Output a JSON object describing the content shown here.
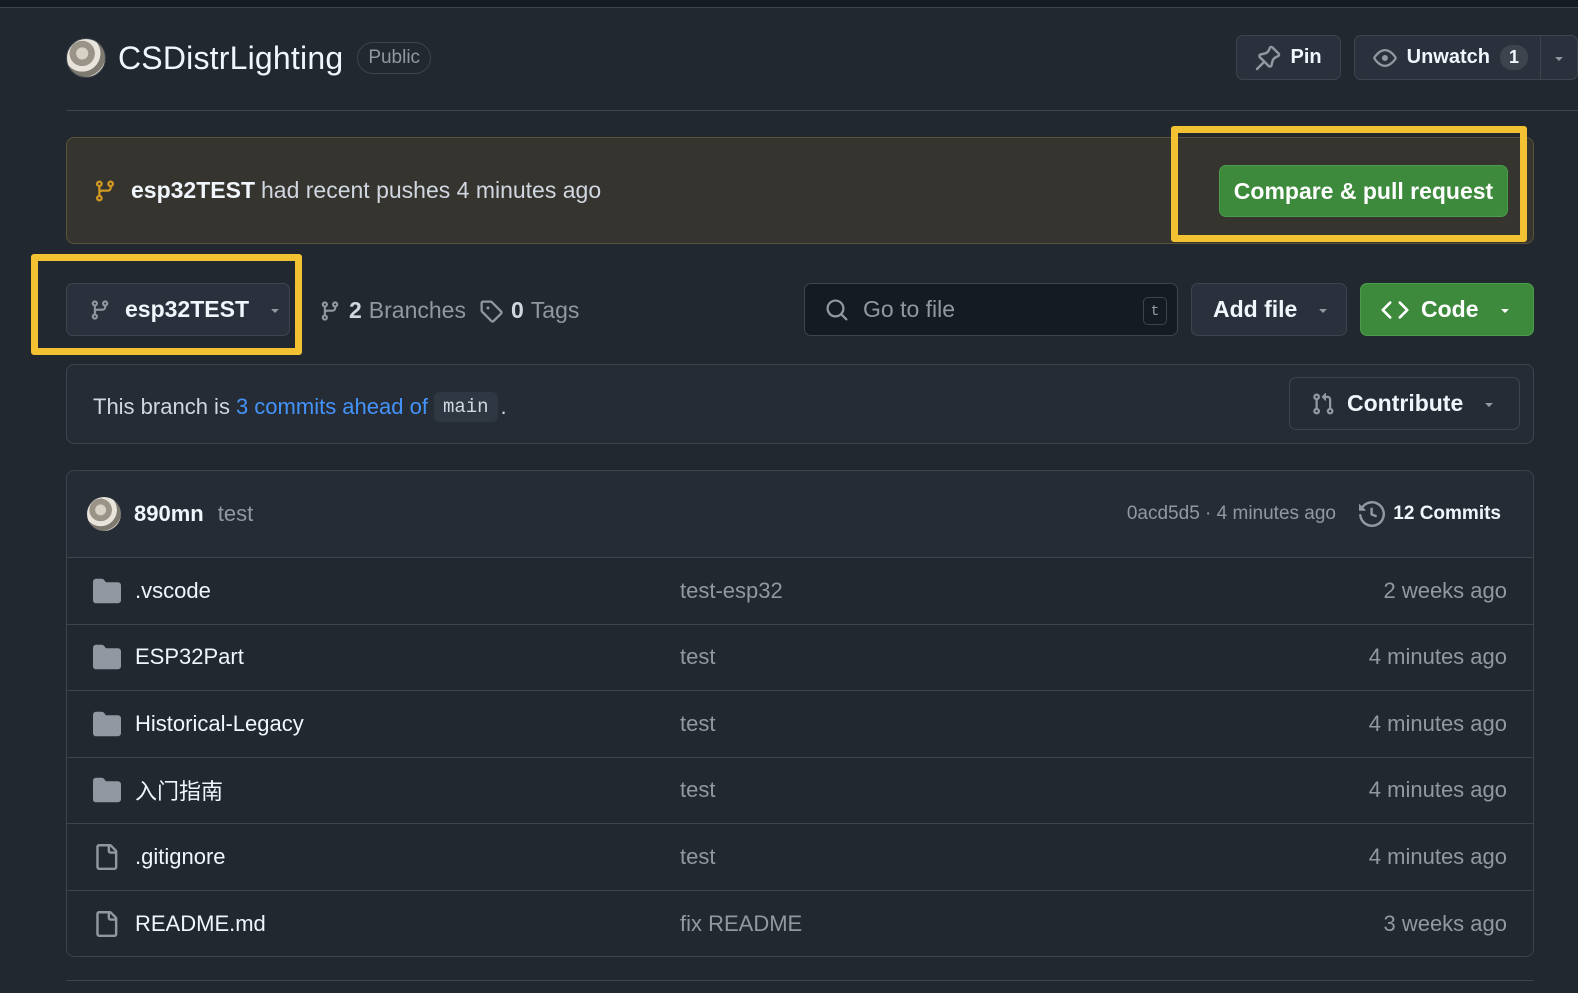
{
  "repo": {
    "name": "CSDistrLighting",
    "visibility": "Public",
    "pin_label": "Pin",
    "watch_label": "Unwatch",
    "watch_count": "1"
  },
  "push_banner": {
    "branch": "esp32TEST",
    "text": "had recent pushes 4 minutes ago",
    "button_label": "Compare & pull request"
  },
  "toolbar": {
    "branch": "esp32TEST",
    "branches_count": "2",
    "branches_label": "Branches",
    "tags_count": "0",
    "tags_label": "Tags",
    "search_placeholder": "Go to file",
    "search_shortcut": "t",
    "add_file_label": "Add file",
    "code_label": "Code"
  },
  "ahead": {
    "prefix": "This branch is",
    "link": "3 commits ahead of",
    "base": "main",
    "suffix": ".",
    "contribute_label": "Contribute"
  },
  "latest_commit": {
    "author": "890mn",
    "message": "test",
    "hash_time": "0acd5d5 · 4 minutes ago",
    "commits_label": "12 Commits"
  },
  "files": [
    {
      "name": ".vscode",
      "type": "folder",
      "message": "test-esp32",
      "date": "2 weeks ago"
    },
    {
      "name": "ESP32Part",
      "type": "folder",
      "message": "test",
      "date": "4 minutes ago"
    },
    {
      "name": "Historical-Legacy",
      "type": "folder",
      "message": "test",
      "date": "4 minutes ago"
    },
    {
      "name": "入门指南",
      "type": "folder",
      "message": "test",
      "date": "4 minutes ago"
    },
    {
      "name": ".gitignore",
      "type": "file",
      "message": "test",
      "date": "4 minutes ago"
    },
    {
      "name": "README.md",
      "type": "file",
      "message": "fix README",
      "date": "3 weeks ago"
    }
  ],
  "colors": {
    "background": "#212830",
    "accent_green": "#3d8a3d",
    "highlight": "#f3c232",
    "link_blue": "#4493f8"
  }
}
